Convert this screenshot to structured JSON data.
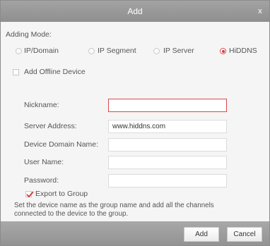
{
  "window": {
    "title": "Add",
    "close_glyph": "x"
  },
  "adding_mode": {
    "label": "Adding Mode:",
    "options": [
      {
        "label": "IP/Domain",
        "selected": false
      },
      {
        "label": "IP Segment",
        "selected": false
      },
      {
        "label": "IP Server",
        "selected": false
      },
      {
        "label": "HiDDNS",
        "selected": true
      }
    ]
  },
  "offline": {
    "label": "Add Offline Device",
    "checked": false
  },
  "form": {
    "nickname": {
      "label": "Nickname:",
      "value": ""
    },
    "server_address": {
      "label": "Server Address:",
      "value": "www.hiddns.com"
    },
    "domain_name": {
      "label": "Device Domain Name:",
      "value": ""
    },
    "user_name": {
      "label": "User Name:",
      "value": ""
    },
    "password": {
      "label": "Password:",
      "value": ""
    }
  },
  "export_group": {
    "label": "Export to Group",
    "checked": true,
    "description_line1": "Set the device name as the group name and add all the channels",
    "description_line2": "connected to the device to the group."
  },
  "buttons": {
    "add": "Add",
    "cancel": "Cancel"
  },
  "colors": {
    "accent": "#d63a3a",
    "title_bar": "#9a9a9a"
  }
}
